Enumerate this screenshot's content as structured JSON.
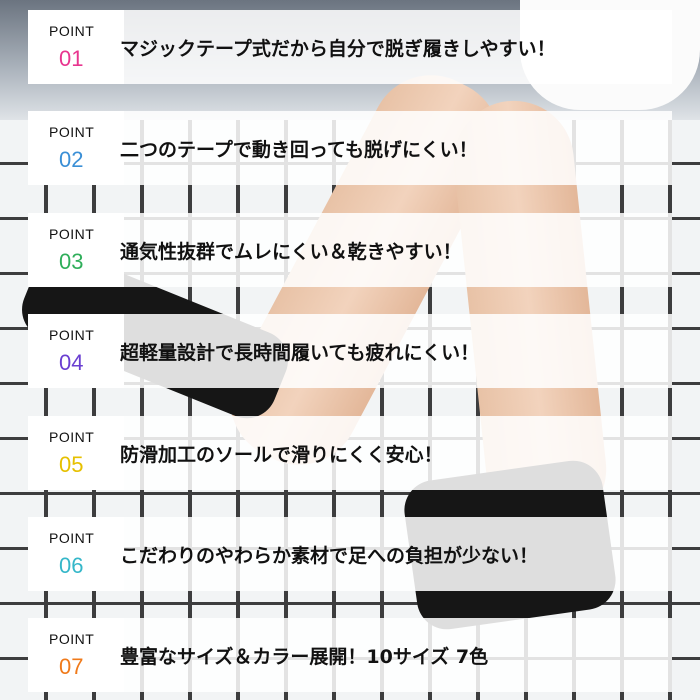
{
  "points": [
    {
      "label": "POINT",
      "number": "01",
      "color": "#e8358f",
      "text": "マジックテープ式だから自分で脱ぎ履きしやすい！"
    },
    {
      "label": "POINT",
      "number": "02",
      "color": "#3a8fd6",
      "text": "二つのテープで動き回っても脱げにくい！"
    },
    {
      "label": "POINT",
      "number": "03",
      "color": "#2fae5a",
      "text": "通気性抜群でムレにくい＆乾きやすい！"
    },
    {
      "label": "POINT",
      "number": "04",
      "color": "#6a3fd1",
      "text": "超軽量設計で長時間履いても疲れにくい！"
    },
    {
      "label": "POINT",
      "number": "05",
      "color": "#e6c000",
      "text": "防滑加工のソールで滑りにくく安心！"
    },
    {
      "label": "POINT",
      "number": "06",
      "color": "#35b7c9",
      "text": "こだわりのやわらか素材で足への負担が少ない！"
    },
    {
      "label": "POINT",
      "number": "07",
      "color": "#f07a1a",
      "text": "豊富なサイズ＆カラー展開！10サイズ 7色"
    }
  ]
}
